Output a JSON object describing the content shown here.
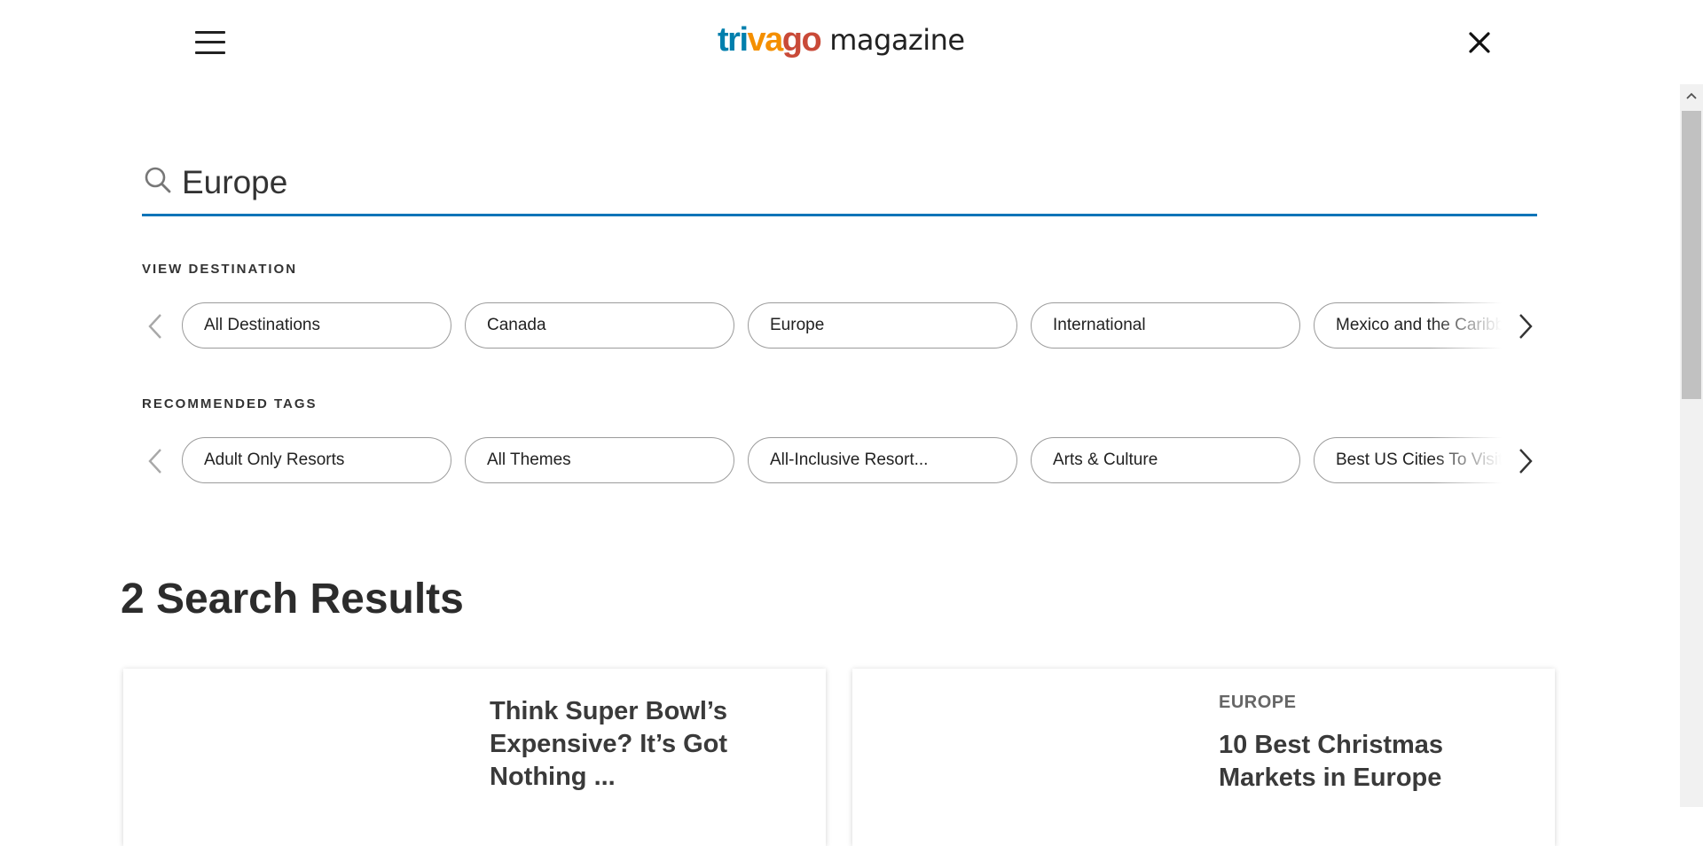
{
  "header": {
    "logo_trivago": "trivago",
    "logo_magazine": "magazine",
    "brand_colors": [
      "#007fad",
      "#f48f00",
      "#c94a38"
    ],
    "menu_icon": "hamburger-icon",
    "close_icon": "close-icon"
  },
  "search": {
    "value": "Europe",
    "icon": "search-icon",
    "accent": "#0a74b8"
  },
  "destinations": {
    "label": "VIEW DESTINATION",
    "items": [
      "All Destinations",
      "Canada",
      "Europe",
      "International",
      "Mexico and the Caribbean"
    ]
  },
  "tags": {
    "label": "RECOMMENDED TAGS",
    "items": [
      "Adult Only Resorts",
      "All Themes",
      "All-Inclusive Resort...",
      "Arts & Culture",
      "Best US Cities To Visit"
    ]
  },
  "results": {
    "heading": "2 Search Results",
    "cards": [
      {
        "category": "",
        "title": "Think Super Bowl’s Expensive? It’s Got Nothing ..."
      },
      {
        "category": "EUROPE",
        "title": "10 Best Christmas Markets in Europe"
      }
    ]
  }
}
